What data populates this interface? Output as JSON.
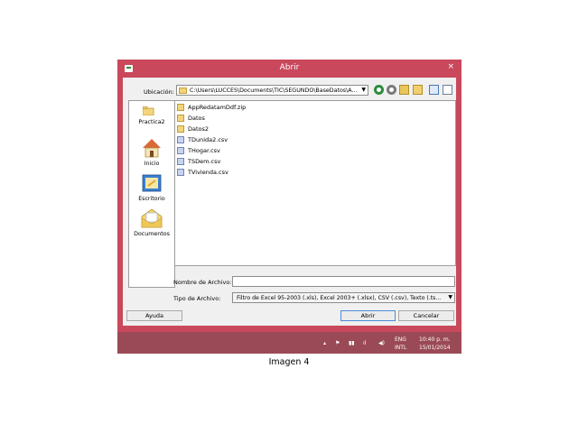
{
  "dialog": {
    "title": "Abrir",
    "close": "×",
    "location_label": "Ubicación:",
    "location_path": "C:\\Users\\LUCCES\\Documents\\TIC\\SEGUNDO\\BaseDatos\\A...",
    "places": [
      {
        "label": "Practica2",
        "icon": "folder-icon"
      },
      {
        "label": "Inicio",
        "icon": "home-icon"
      },
      {
        "label": "Escritorio",
        "icon": "desktop-icon"
      },
      {
        "label": "Documentos",
        "icon": "documents-icon"
      }
    ],
    "files": [
      {
        "name": "AppRedatamDdf.zip",
        "icon": "folder"
      },
      {
        "name": "Datos",
        "icon": "folder"
      },
      {
        "name": "Datos2",
        "icon": "folder"
      },
      {
        "name": "TDunida2.csv",
        "icon": "doc"
      },
      {
        "name": "THogar.csv",
        "icon": "doc"
      },
      {
        "name": "TSDem.csv",
        "icon": "doc"
      },
      {
        "name": "TVivienda.csv",
        "icon": "doc"
      }
    ],
    "filename_label": "Nombre de Archivo:",
    "filename_value": "",
    "filetype_label": "Tipo de Archivo:",
    "filetype_value": "Filtro de Excel 95-2003 (.xls), Excel 2003+ (.xlsx), CSV (.csv), Texto (.ts...",
    "help_button": "Ayuda",
    "open_button": "Abrir",
    "cancel_button": "Cancelar"
  },
  "taskbar": {
    "lang_top": "ENG",
    "lang_bottom": "INTL",
    "time": "10:40 p. m.",
    "date": "15/01/2014"
  },
  "caption": "Imagen 4",
  "colors": {
    "titlebar": "#c9485b",
    "taskbar": "#9a4a56",
    "client": "#f0f0f0"
  }
}
